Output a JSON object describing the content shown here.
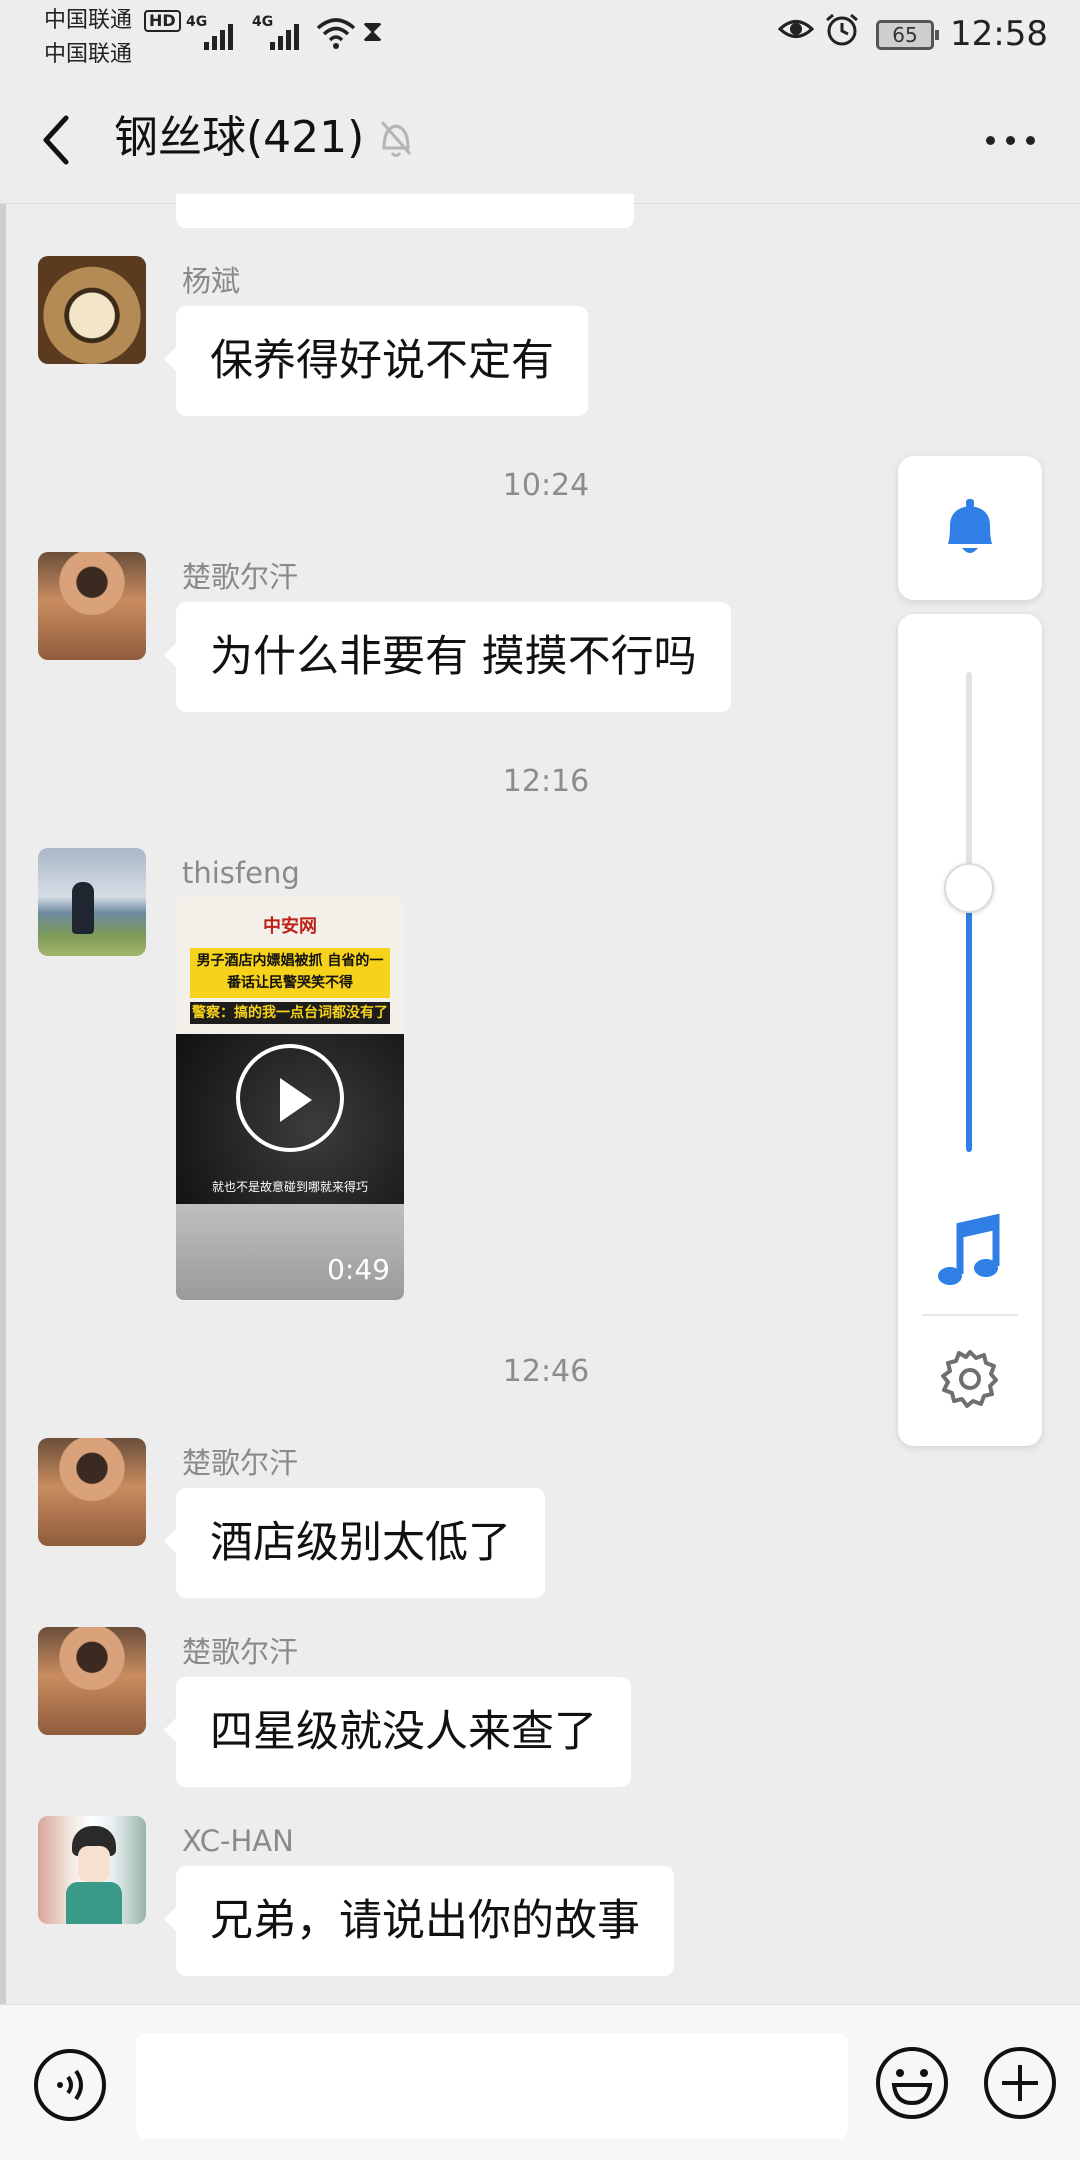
{
  "status_bar": {
    "carrier_1": "中国联通",
    "carrier_2": "中国联通",
    "hd_badge": "HD",
    "network_1": "4G",
    "network_2": "4G",
    "battery_level": "65",
    "time": "12:58"
  },
  "header": {
    "title": "钢丝球(421)"
  },
  "messages": [
    {
      "sender": "杨斌",
      "text": "保养得好说不定有"
    },
    {
      "timestamp": "10:24"
    },
    {
      "sender": "楚歌尔汗",
      "text": "为什么非要有 摸摸不行吗"
    },
    {
      "timestamp": "12:16"
    },
    {
      "sender": "thisfeng",
      "video": {
        "source_logo": "中安网",
        "headline": "男子酒店内嫖娼被抓 自省的一番话让民警哭笑不得",
        "subhead": "警察：搞的我一点台词都没有了",
        "caption": "就也不是故意碰到哪就来得巧",
        "duration": "0:49"
      }
    },
    {
      "timestamp": "12:46"
    },
    {
      "sender": "楚歌尔汗",
      "text": "酒店级别太低了"
    },
    {
      "sender": "楚歌尔汗",
      "text": "四星级就没人来查了"
    },
    {
      "sender": "XC-HAN",
      "text": "兄弟，请说出你的故事"
    }
  ],
  "volume_panel": {
    "level": 0.55,
    "accent_color": "#2f7fe6"
  },
  "input_bar": {
    "placeholder": ""
  },
  "icons": [
    "back-icon",
    "mute-icon",
    "more-icon",
    "bell-icon",
    "music-icon",
    "settings-icon",
    "voice-icon",
    "emoji-icon",
    "plus-icon"
  ]
}
